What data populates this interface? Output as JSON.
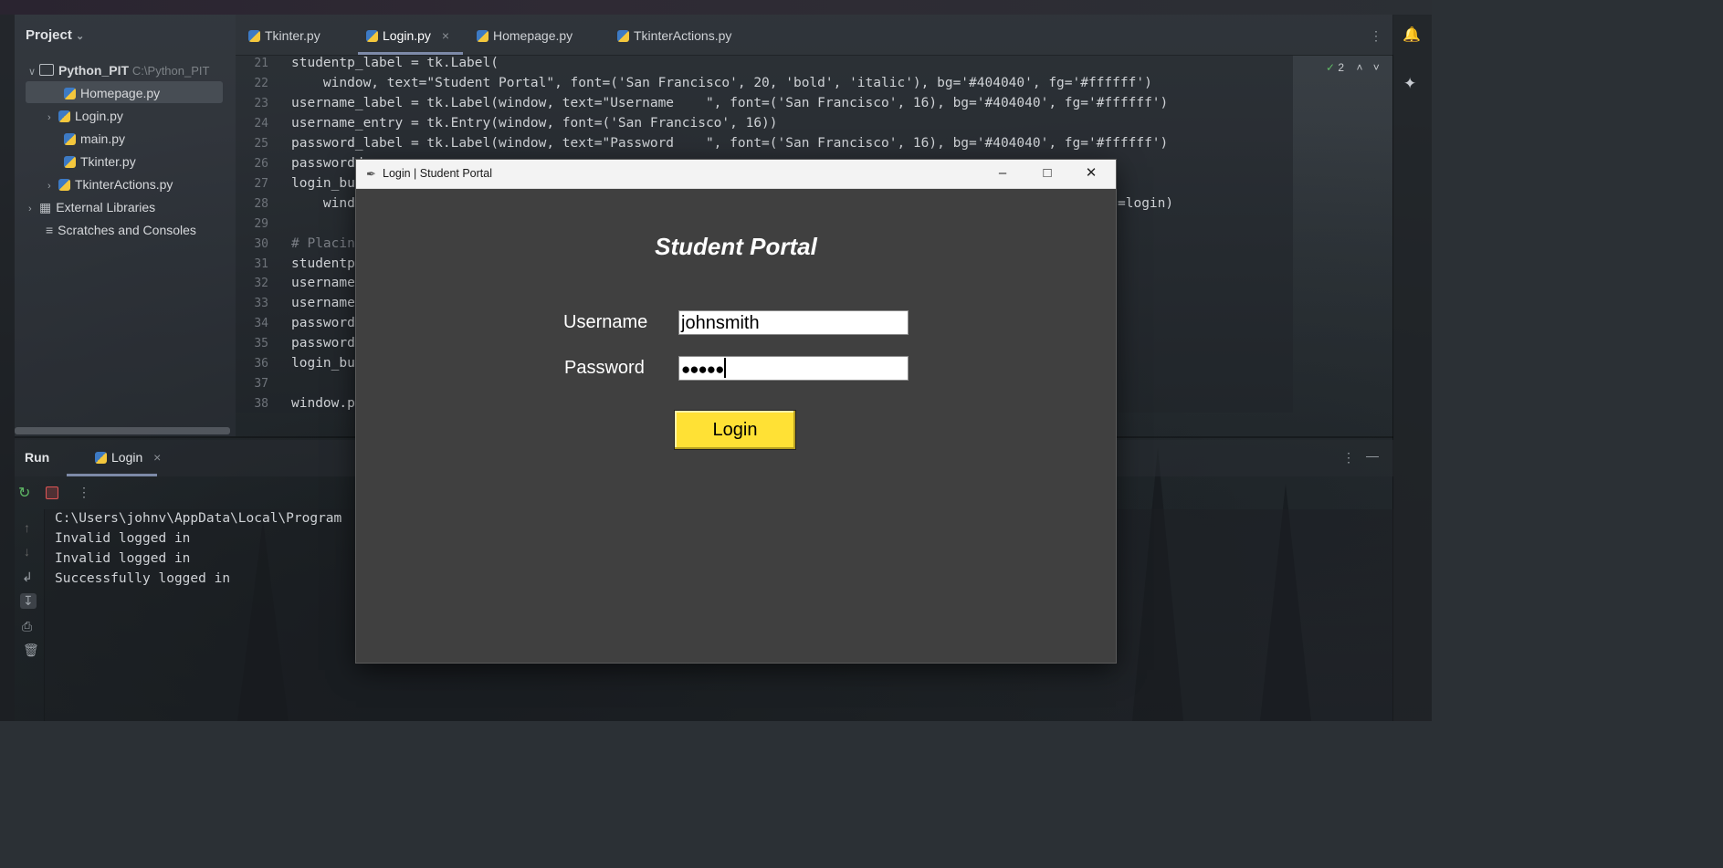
{
  "ide": {
    "project_panel": {
      "title": "Project",
      "root": {
        "name": "Python_PIT",
        "path": "C:\\Python_PIT"
      },
      "files": [
        "Homepage.py",
        "Login.py",
        "main.py",
        "Tkinter.py",
        "TkinterActions.py"
      ],
      "external_libraries": "External Libraries",
      "scratches": "Scratches and Consoles"
    },
    "tabs": [
      {
        "label": "Tkinter.py"
      },
      {
        "label": "Login.py"
      },
      {
        "label": "Homepage.py"
      },
      {
        "label": "TkinterActions.py"
      }
    ],
    "inspections": "2",
    "editor_lines": [
      {
        "n": "21",
        "text": "studentp_label = tk.Label("
      },
      {
        "n": "22",
        "text": "    window, text=\"Student Portal\", font=('San Francisco', 20, 'bold', 'italic'), bg='#404040', fg='#ffffff')"
      },
      {
        "n": "23",
        "text": "username_label = tk.Label(window, text=\"Username    \", font=('San Francisco', 16), bg='#404040', fg='#ffffff')"
      },
      {
        "n": "24",
        "text": "username_entry = tk.Entry(window, font=('San Francisco', 16))"
      },
      {
        "n": "25",
        "text": "password_label = tk.Label(window, text=\"Password    \", font=('San Francisco', 16), bg='#404040', fg='#ffffff')"
      },
      {
        "n": "26",
        "text": "passwordd"
      },
      {
        "n": "27",
        "text": "login_bu"
      },
      {
        "n": "28",
        "text": "    windo",
        "tail": "=login)"
      },
      {
        "n": "29",
        "text": ""
      },
      {
        "n": "30",
        "text": "# Placin"
      },
      {
        "n": "31",
        "text": "studentp"
      },
      {
        "n": "32",
        "text": "username"
      },
      {
        "n": "33",
        "text": "username"
      },
      {
        "n": "34",
        "text": "password"
      },
      {
        "n": "35",
        "text": "password"
      },
      {
        "n": "36",
        "text": "login_bu"
      },
      {
        "n": "37",
        "text": ""
      },
      {
        "n": "38",
        "text": "window.p"
      }
    ],
    "run": {
      "label": "Run",
      "tab": "Login",
      "console": [
        "C:\\Users\\johnv\\AppData\\Local\\Program",
        "Invalid logged in",
        "Invalid logged in",
        "Successfully logged in"
      ]
    }
  },
  "login_window": {
    "title": "Login | Student Portal",
    "heading": "Student Portal",
    "username_label": "Username",
    "username_value": "johnsmith",
    "password_label": "Password",
    "password_value": "●●●●●",
    "login_button": "Login",
    "colors": {
      "bg": "#404040",
      "button": "#ffe135"
    }
  }
}
